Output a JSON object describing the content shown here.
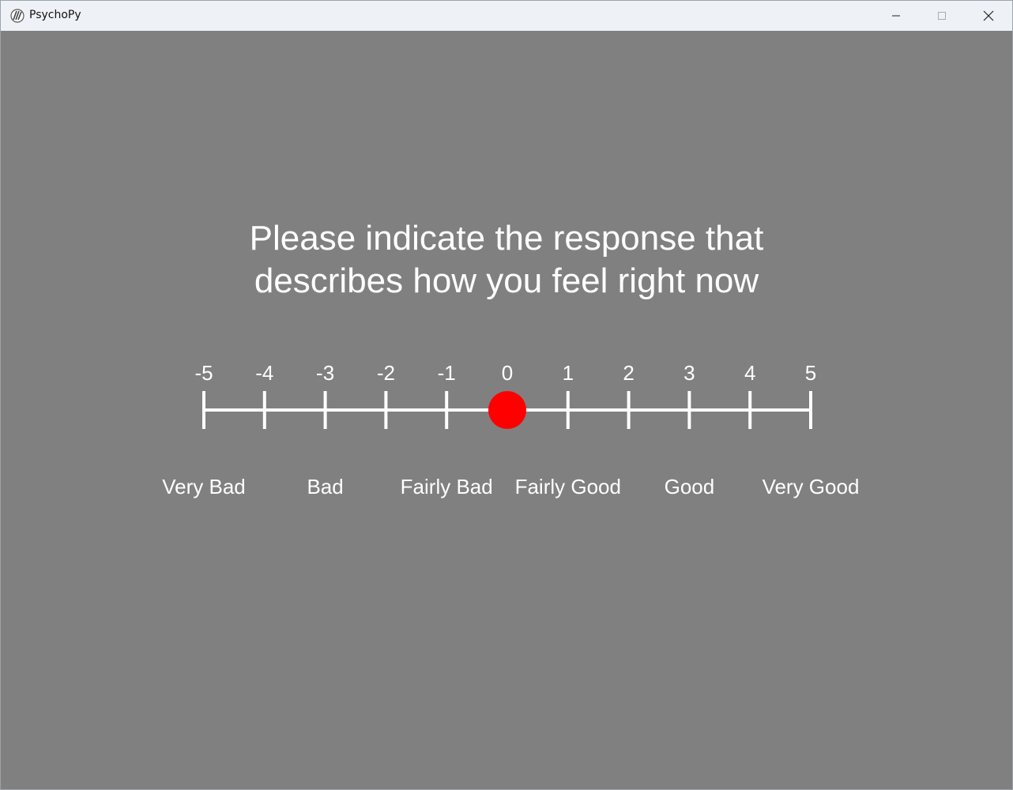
{
  "window": {
    "title": "PsychoPy",
    "background_color": "#808080",
    "icons": {
      "app": "psychopy-logo-icon",
      "minimize": "minimize-icon",
      "maximize": "maximize-icon",
      "close": "close-icon"
    }
  },
  "question": {
    "line1": "Please indicate the response that",
    "line2": "describes how you feel right now"
  },
  "rating_scale": {
    "ticks": [
      "-5",
      "-4",
      "-3",
      "-2",
      "-1",
      "0",
      "1",
      "2",
      "3",
      "4",
      "5"
    ],
    "tick_values": [
      -5,
      -4,
      -3,
      -2,
      -1,
      0,
      1,
      2,
      3,
      4,
      5
    ],
    "labels": [
      {
        "text": "Very Bad",
        "value": -5
      },
      {
        "text": "Bad",
        "value": -3
      },
      {
        "text": "Fairly Bad",
        "value": -1
      },
      {
        "text": "Fairly Good",
        "value": 1
      },
      {
        "text": "Good",
        "value": 3
      },
      {
        "text": "Very Good",
        "value": 5
      }
    ],
    "current_value": 0,
    "marker_color": "#ff0000",
    "line_color": "#ffffff"
  }
}
